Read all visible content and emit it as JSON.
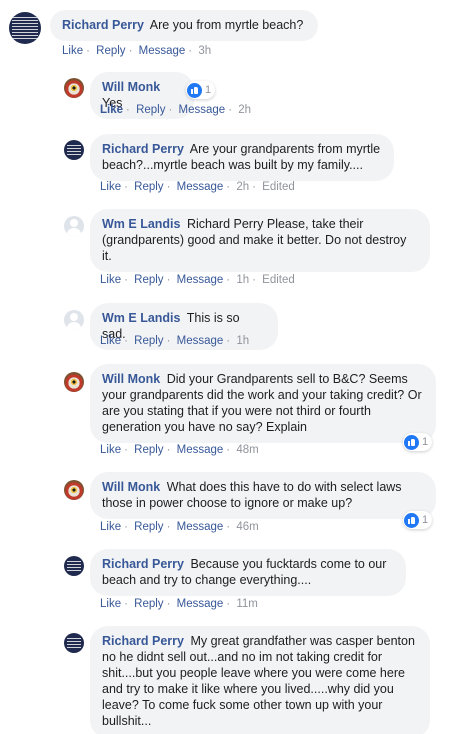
{
  "comments": [
    {
      "author": "Richard Perry",
      "text": "Are you from myrtle beach?",
      "actions": [
        "Like",
        "Reply",
        "Message"
      ],
      "time": "3h"
    },
    {
      "author": "Will Monk",
      "text": "Yes",
      "actions": [
        "Like",
        "Reply",
        "Message"
      ],
      "time": "2h",
      "likes": "1"
    },
    {
      "author": "Richard Perry",
      "text": "Are your grandparents from myrtle beach?...myrtle beach was built by my family....",
      "actions": [
        "Like",
        "Reply",
        "Message"
      ],
      "time": "2h",
      "edited": "Edited"
    },
    {
      "author": "Wm E Landis",
      "text": "Richard Perry Please, take their (grandparents) good and make it better. Do not destroy it.",
      "actions": [
        "Like",
        "Reply",
        "Message"
      ],
      "time": "1h",
      "edited": "Edited"
    },
    {
      "author": "Wm E Landis",
      "text": "This is so sad.",
      "actions": [
        "Like",
        "Reply",
        "Message"
      ],
      "time": "1h"
    },
    {
      "author": "Will Monk",
      "text": "Did your Grandparents sell to B&C? Seems your grandparents did the work and your taking credit? Or are you stating that if you were not third or fourth generation you have no say? Explain",
      "actions": [
        "Like",
        "Reply",
        "Message"
      ],
      "time": "48m",
      "likes": "1"
    },
    {
      "author": "Will Monk",
      "text": "What does this have to do with select laws those in power choose to ignore or make up?",
      "actions": [
        "Like",
        "Reply",
        "Message"
      ],
      "time": "46m",
      "likes": "1"
    },
    {
      "author": "Richard Perry",
      "text": "Because you fucktards come to our beach and try to change everything....",
      "actions": [
        "Like",
        "Reply",
        "Message"
      ],
      "time": "11m"
    },
    {
      "author": "Richard Perry",
      "text": "My great grandfather was casper benton no he didnt sell out...and no im not taking credit for shit....but you people leave where you were come here and try to make it like where you lived.....why did you leave? To come fuck some other town up with your bullshit..."
    }
  ],
  "colors": {
    "link": "#385898",
    "bubble": "#f2f3f5",
    "meta": "#90949c",
    "like": "#2078f4"
  }
}
